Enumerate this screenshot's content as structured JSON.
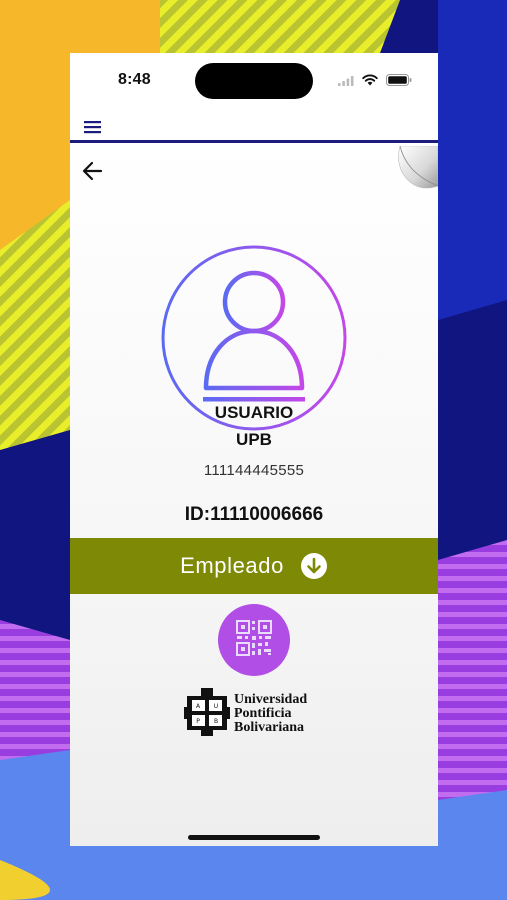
{
  "status_bar": {
    "time": "8:48"
  },
  "profile": {
    "name_line1": "USUARIO",
    "name_line2": "UPB",
    "document_number": "111144445555",
    "id_text": "ID:11110006666"
  },
  "role_bar": {
    "label": "Empleado"
  },
  "logo": {
    "line1": "Universidad",
    "line2": "Pontificia",
    "line3": "Bolivariana",
    "seal_text": "AUPB"
  },
  "colors": {
    "role_bar": "#7e8a05",
    "qr_button": "#b14ee6",
    "avatar_gradient_start": "#5a6bf2",
    "avatar_gradient_end": "#c447e8",
    "topbar_border": "#1c1c7c"
  },
  "icons": [
    "menu-icon",
    "back-arrow-icon",
    "page-curl-icon",
    "user-avatar-icon",
    "arrow-down-circle-icon",
    "qr-code-icon",
    "signal-icon",
    "wifi-icon",
    "battery-icon"
  ]
}
